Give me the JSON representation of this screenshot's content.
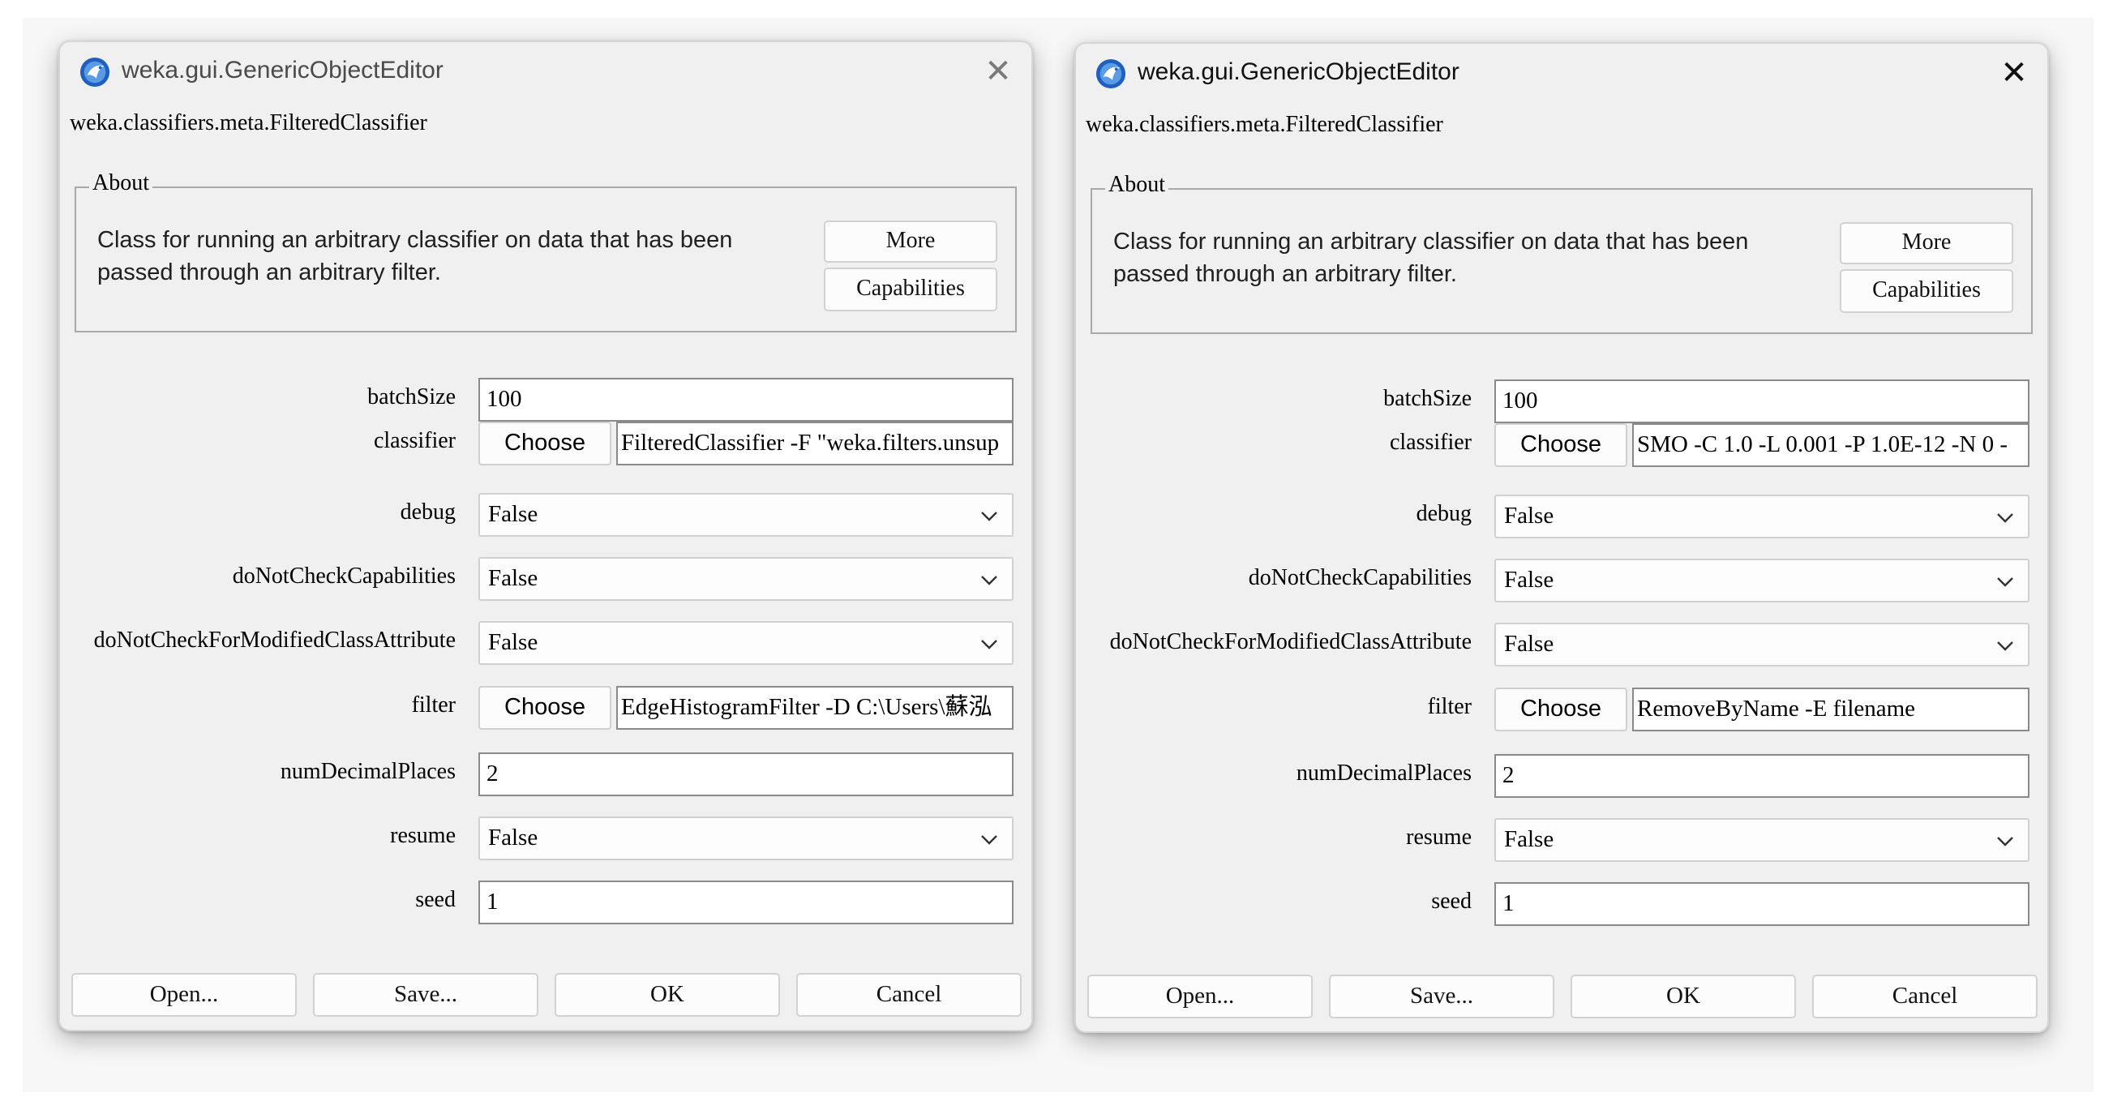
{
  "left_dialog": {
    "title": "weka.gui.GenericObjectEditor",
    "class_name": "weka.classifiers.meta.FilteredClassifier",
    "about": {
      "legend": "About",
      "text": "Class for running an arbitrary classifier on data that has been passed through an arbitrary filter.",
      "more_label": "More",
      "capabilities_label": "Capabilities"
    },
    "fields": {
      "batchSize": {
        "label": "batchSize",
        "value": "100"
      },
      "classifier": {
        "label": "classifier",
        "choose_label": "Choose",
        "value": "FilteredClassifier -F \"weka.filters.unsup"
      },
      "debug": {
        "label": "debug",
        "value": "False"
      },
      "doNotCheckCapabilities": {
        "label": "doNotCheckCapabilities",
        "value": "False"
      },
      "doNotCheckForModifiedClassAttribute": {
        "label": "doNotCheckForModifiedClassAttribute",
        "value": "False"
      },
      "filter": {
        "label": "filter",
        "choose_label": "Choose",
        "value": "EdgeHistogramFilter -D C:\\Users\\蘇泓"
      },
      "numDecimalPlaces": {
        "label": "numDecimalPlaces",
        "value": "2"
      },
      "resume": {
        "label": "resume",
        "value": "False"
      },
      "seed": {
        "label": "seed",
        "value": "1"
      }
    },
    "buttons": {
      "open": "Open...",
      "save": "Save...",
      "ok": "OK",
      "cancel": "Cancel"
    }
  },
  "right_dialog": {
    "title": "weka.gui.GenericObjectEditor",
    "class_name": "weka.classifiers.meta.FilteredClassifier",
    "about": {
      "legend": "About",
      "text": "Class for running an arbitrary classifier on data that has been passed through an arbitrary filter.",
      "more_label": "More",
      "capabilities_label": "Capabilities"
    },
    "fields": {
      "batchSize": {
        "label": "batchSize",
        "value": "100"
      },
      "classifier": {
        "label": "classifier",
        "choose_label": "Choose",
        "value": "SMO -C 1.0 -L 0.001 -P 1.0E-12 -N 0 -"
      },
      "debug": {
        "label": "debug",
        "value": "False"
      },
      "doNotCheckCapabilities": {
        "label": "doNotCheckCapabilities",
        "value": "False"
      },
      "doNotCheckForModifiedClassAttribute": {
        "label": "doNotCheckForModifiedClassAttribute",
        "value": "False"
      },
      "filter": {
        "label": "filter",
        "choose_label": "Choose",
        "value": "RemoveByName -E filename"
      },
      "numDecimalPlaces": {
        "label": "numDecimalPlaces",
        "value": "2"
      },
      "resume": {
        "label": "resume",
        "value": "False"
      },
      "seed": {
        "label": "seed",
        "value": "1"
      }
    },
    "buttons": {
      "open": "Open...",
      "save": "Save...",
      "ok": "OK",
      "cancel": "Cancel"
    }
  },
  "icons": {
    "app": "weka-bird-icon",
    "close": "close-icon",
    "dropdown": "chevron-down-icon"
  },
  "colors": {
    "window_bg": "#f0f0f0",
    "app_icon_blue": "#1f5fbf"
  }
}
